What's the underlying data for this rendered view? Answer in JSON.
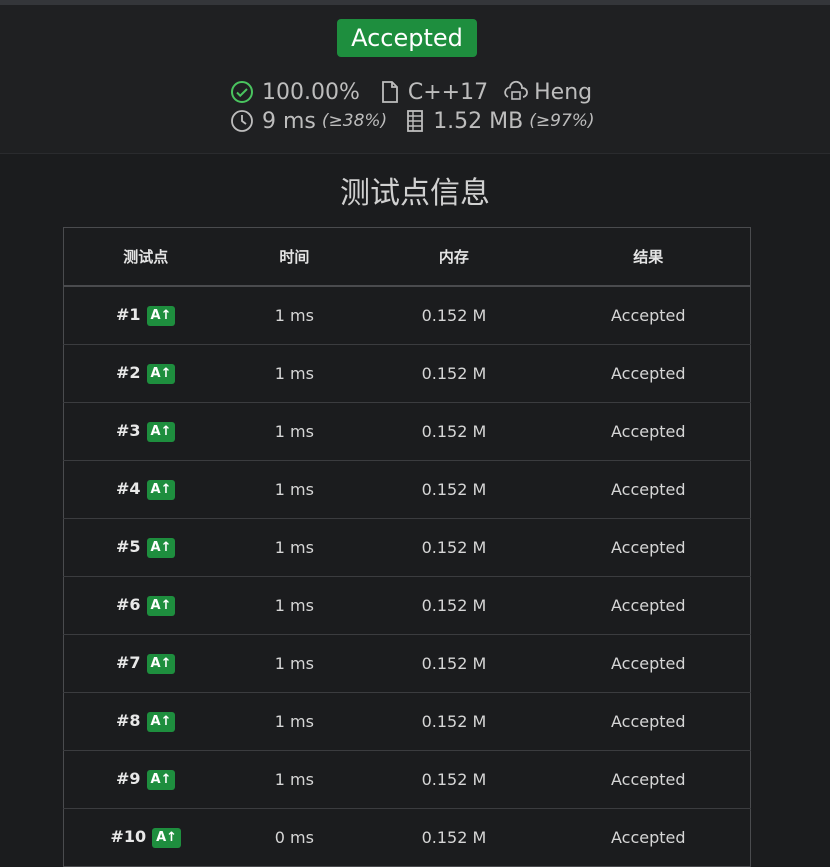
{
  "status": {
    "label": "Accepted",
    "color": "#1e8e3e"
  },
  "summary": {
    "score": "100.00%",
    "language": "C++17",
    "user": "Heng",
    "time": "9 ms",
    "time_rank": "(≥38%)",
    "memory": "1.52 MB",
    "memory_rank": "(≥97%)"
  },
  "section_title": "测试点信息",
  "table": {
    "headers": [
      "测试点",
      "时间",
      "内存",
      "结果"
    ],
    "rows": [
      {
        "id": "#1",
        "tag": "A↑",
        "time": "1 ms",
        "memory": "0.152 M",
        "result": "Accepted"
      },
      {
        "id": "#2",
        "tag": "A↑",
        "time": "1 ms",
        "memory": "0.152 M",
        "result": "Accepted"
      },
      {
        "id": "#3",
        "tag": "A↑",
        "time": "1 ms",
        "memory": "0.152 M",
        "result": "Accepted"
      },
      {
        "id": "#4",
        "tag": "A↑",
        "time": "1 ms",
        "memory": "0.152 M",
        "result": "Accepted"
      },
      {
        "id": "#5",
        "tag": "A↑",
        "time": "1 ms",
        "memory": "0.152 M",
        "result": "Accepted"
      },
      {
        "id": "#6",
        "tag": "A↑",
        "time": "1 ms",
        "memory": "0.152 M",
        "result": "Accepted"
      },
      {
        "id": "#7",
        "tag": "A↑",
        "time": "1 ms",
        "memory": "0.152 M",
        "result": "Accepted"
      },
      {
        "id": "#8",
        "tag": "A↑",
        "time": "1 ms",
        "memory": "0.152 M",
        "result": "Accepted"
      },
      {
        "id": "#9",
        "tag": "A↑",
        "time": "1 ms",
        "memory": "0.152 M",
        "result": "Accepted"
      },
      {
        "id": "#10",
        "tag": "A↑",
        "time": "0 ms",
        "memory": "0.152 M",
        "result": "Accepted"
      }
    ]
  },
  "colors": {
    "accepted_text": "#4ac45f",
    "background": "#1b1c1e"
  },
  "icons": [
    "check-circle-icon",
    "file-icon",
    "user-cloud-icon",
    "clock-icon",
    "memory-icon"
  ]
}
